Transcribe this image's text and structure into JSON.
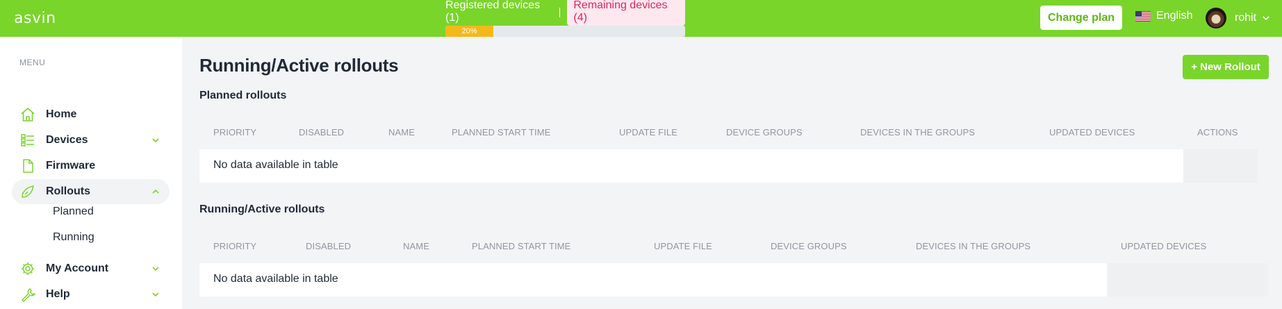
{
  "app": {
    "logo": "asvin",
    "registered_devices": "Registered devices (1)",
    "separator": "|",
    "remaining_devices": "Remaining devices (4)",
    "progress_percent": 20,
    "progress_label": "20%",
    "change_plan": "Change plan",
    "language": "English",
    "username": "rohit"
  },
  "sidebar": {
    "menu_label": "MENU",
    "items": [
      {
        "label": "Home",
        "icon": "home-icon"
      },
      {
        "label": "Devices",
        "icon": "devices-icon"
      },
      {
        "label": "Firmware",
        "icon": "file-icon"
      },
      {
        "label": "Rollouts",
        "icon": "rocket-icon"
      },
      {
        "label": "My Account",
        "icon": "gear-icon"
      },
      {
        "label": "Help",
        "icon": "wrench-icon"
      }
    ],
    "rollout_subitems": [
      "Planned",
      "Running"
    ]
  },
  "main": {
    "title": "Running/Active rollouts",
    "new_rollout_button": "+ New Rollout",
    "planned": {
      "title": "Planned rollouts",
      "columns": [
        "PRIORITY",
        "DISABLED",
        "NAME",
        "PLANNED START TIME",
        "UPDATE FILE",
        "DEVICE GROUPS",
        "DEVICES IN THE GROUPS",
        "UPDATED DEVICES",
        "ACTIONS"
      ],
      "empty_message": "No data available in table"
    },
    "running": {
      "title": "Running/Active rollouts",
      "columns": [
        "PRIORITY",
        "DISABLED",
        "NAME",
        "PLANNED START TIME",
        "UPDATE FILE",
        "DEVICE GROUPS",
        "DEVICES IN THE GROUPS",
        "UPDATED DEVICES"
      ],
      "empty_message": "No data available in table"
    }
  },
  "colors": {
    "brand_green": "#79d52a",
    "progress_fill": "#f4b81a",
    "remaining_text": "#e0245e"
  }
}
